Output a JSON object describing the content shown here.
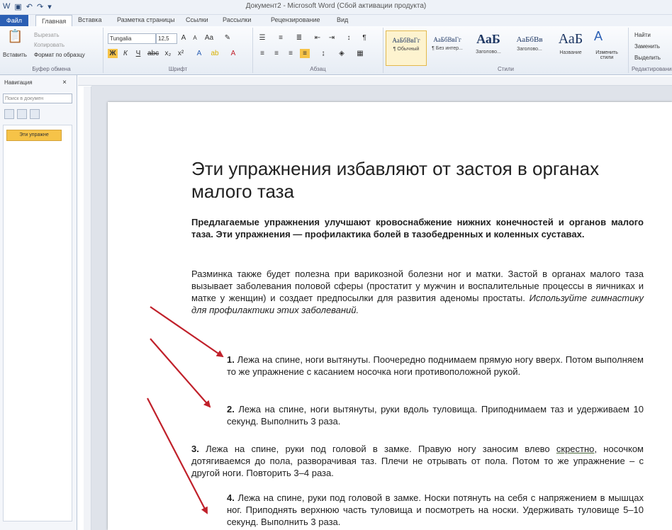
{
  "window": {
    "title": "Документ2 - Microsoft Word (Сбой активации продукта)"
  },
  "tabs": [
    {
      "label": "Файл"
    },
    {
      "label": "Главная"
    },
    {
      "label": "Вставка"
    },
    {
      "label": "Разметка страницы"
    },
    {
      "label": "Ссылки"
    },
    {
      "label": "Рассылки"
    },
    {
      "label": "Рецензирование"
    },
    {
      "label": "Вид"
    }
  ],
  "ribbon": {
    "clipboard": {
      "paste": "Вставить",
      "cut": "Вырезать",
      "copy": "Копировать",
      "format_painter": "Формат по образцу",
      "group": "Буфер обмена"
    },
    "font": {
      "name": "Tungalia",
      "size": "12,5",
      "group": "Шрифт"
    },
    "paragraph": {
      "group": "Абзац"
    },
    "styles": {
      "items": [
        {
          "preview": "АаБбВвГг",
          "name": "¶ Обычный"
        },
        {
          "preview": "АаБбВвГг",
          "name": "¶ Без интер..."
        },
        {
          "preview": "АаБ",
          "name": "Заголово..."
        },
        {
          "preview": "АаБбВв",
          "name": "Заголово..."
        },
        {
          "preview": "АаБ",
          "name": "Название"
        }
      ],
      "change": "Изменить стили",
      "group": "Стили"
    },
    "editing": {
      "find": "Найти",
      "replace": "Заменить",
      "select": "Выделить",
      "group": "Редактирование"
    }
  },
  "nav_pane": {
    "title": "Навигация",
    "search_placeholder": "Поиск в докумен",
    "active_heading": "Эти упражне"
  },
  "document": {
    "title": "Эти упражнения избавляют от застоя в органах малого таза",
    "intro_bold": "Предлагаемые упражнения улучшают кровоснабжение нижних конечностей и органов малого таза. Эти упражнения — профилактика болей в тазобедренных и коленных суставах.",
    "para2_plain": "Разминка также будет полезна при варикозной болезни ног и матки. Застой в органах малого таза вызывает заболевания половой сферы (простатит у мужчин и воспалительные процессы в яичниках и матке у женщин) и создает предпосылки для развития аденомы простаты.",
    "para2_italic": "Используйте гимнастику для профилактики этих заболеваний.",
    "items": [
      {
        "num": "1.",
        "text": "Лежа на спине, ноги вытянуты. Поочередно поднимаем прямую ногу вверх. Потом выполняем то же упражнение с касанием носочка ноги противоположной рукой."
      },
      {
        "num": "2.",
        "text": "Лежа на спине, ноги вытянуты, руки вдоль туловища. Приподнимаем таз и удерживаем 10 секунд. Выполнить 3 раза."
      },
      {
        "num": "3.",
        "text_a": "Лежа на спине, руки под головой в замке. Правую ногу заносим влево ",
        "text_ul": "скрестно",
        "text_b": ", носочком дотягиваемся до пола, разворачивая таз. Плечи не отрывать от пола. Потом то же упражнение – с другой ноги. Повторить 3–4 раза."
      },
      {
        "num": "4.",
        "text": "Лежа на спине, руки под головой в замке. Носки потянуть на себя с напряжением в мышцах ног. Приподнять верхнюю часть туловища и посмотреть на носки. Удерживать туловище 5–10 секунд. Выполнить 3 раза."
      }
    ]
  },
  "colors": {
    "arrow": "#c0202a",
    "file_tab": "#2b5fb4"
  }
}
